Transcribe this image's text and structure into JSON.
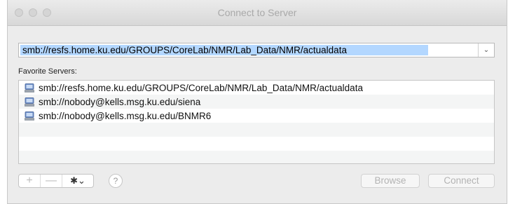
{
  "window": {
    "title": "Connect to Server"
  },
  "address": {
    "value": "smb://resfs.home.ku.edu/GROUPS/CoreLab/NMR/Lab_Data/NMR/actualdata",
    "dropdown_icon": "chevron-down"
  },
  "favorites": {
    "label": "Favorite Servers:",
    "items": [
      {
        "label": "smb://resfs.home.ku.edu/GROUPS/CoreLab/NMR/Lab_Data/NMR/actualdata",
        "icon": "server-icon"
      },
      {
        "label": "smb://nobody@kells.msg.ku.edu/siena",
        "icon": "server-icon"
      },
      {
        "label": "smb://nobody@kells.msg.ku.edu/BNMR6",
        "icon": "server-icon"
      }
    ]
  },
  "toolbar": {
    "add_label": "+",
    "remove_label": "—",
    "gear_label": "✱⌄",
    "help_label": "?",
    "browse_label": "Browse",
    "connect_label": "Connect"
  },
  "colors": {
    "selection": "#b3d7ff",
    "window_bg": "#ececec",
    "disabled_text": "#b3b3b3"
  }
}
